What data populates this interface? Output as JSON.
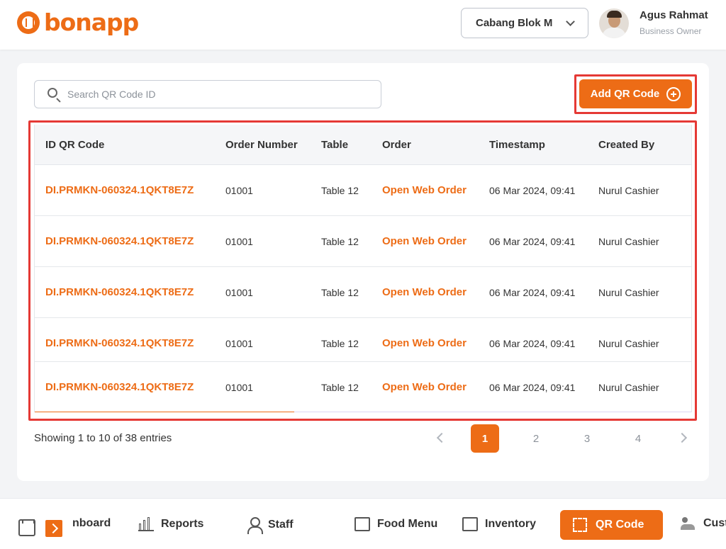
{
  "brand": {
    "name": "bonapp"
  },
  "header": {
    "branch": "Cabang Blok M",
    "user": {
      "name": "Agus Rahmat",
      "role": "Business Owner"
    }
  },
  "toolbar": {
    "search_placeholder": "Search QR Code ID",
    "add_label": "Add QR Code"
  },
  "table": {
    "columns": [
      "ID QR Code",
      "Order Number",
      "Table",
      "Order",
      "Timestamp",
      "Created By"
    ],
    "rows": [
      {
        "id": "DI.PRMKN-060324.1QKT8E7Z",
        "order_number": "01001",
        "table": "Table 12",
        "order": "Open Web Order",
        "timestamp": "06 Mar 2024, 09:41",
        "created_by": "Nurul Cashier"
      },
      {
        "id": "DI.PRMKN-060324.1QKT8E7Z",
        "order_number": "01001",
        "table": "Table 12",
        "order": "Open Web Order",
        "timestamp": "06 Mar 2024, 09:41",
        "created_by": "Nurul Cashier"
      },
      {
        "id": "DI.PRMKN-060324.1QKT8E7Z",
        "order_number": "01001",
        "table": "Table 12",
        "order": "Open Web Order",
        "timestamp": "06 Mar 2024, 09:41",
        "created_by": "Nurul Cashier"
      },
      {
        "id": "DI.PRMKN-060324.1QKT8E7Z",
        "order_number": "01001",
        "table": "Table 12",
        "order": "Open Web Order",
        "timestamp": "06 Mar 2024, 09:41",
        "created_by": "Nurul Cashier"
      },
      {
        "id": "DI.PRMKN-060324.1QKT8E7Z",
        "order_number": "01001",
        "table": "Table 12",
        "order": "Open Web Order",
        "timestamp": "06 Mar 2024, 09:41",
        "created_by": "Nurul Cashier"
      }
    ]
  },
  "pagination": {
    "summary": "Showing 1 to 10 of 38 entries",
    "pages": [
      "1",
      "2",
      "3",
      "4"
    ],
    "current": "1"
  },
  "bottom_nav": {
    "dashboard": "nboard",
    "reports": "Reports",
    "staff": "Staff",
    "food_menu": "Food Menu",
    "inventory": "Inventory",
    "qr_code": "QR Code",
    "customers": "Cust"
  },
  "colors": {
    "accent": "#ed6c16",
    "highlight": "#e53935"
  },
  "icons": [
    "search-icon",
    "chevron-down-icon",
    "plus-circle-icon",
    "store-icon",
    "chevron-right-icon",
    "bar-chart-icon",
    "person-icon",
    "food-menu-icon",
    "inventory-icon",
    "qr-code-icon",
    "customers-icon"
  ]
}
